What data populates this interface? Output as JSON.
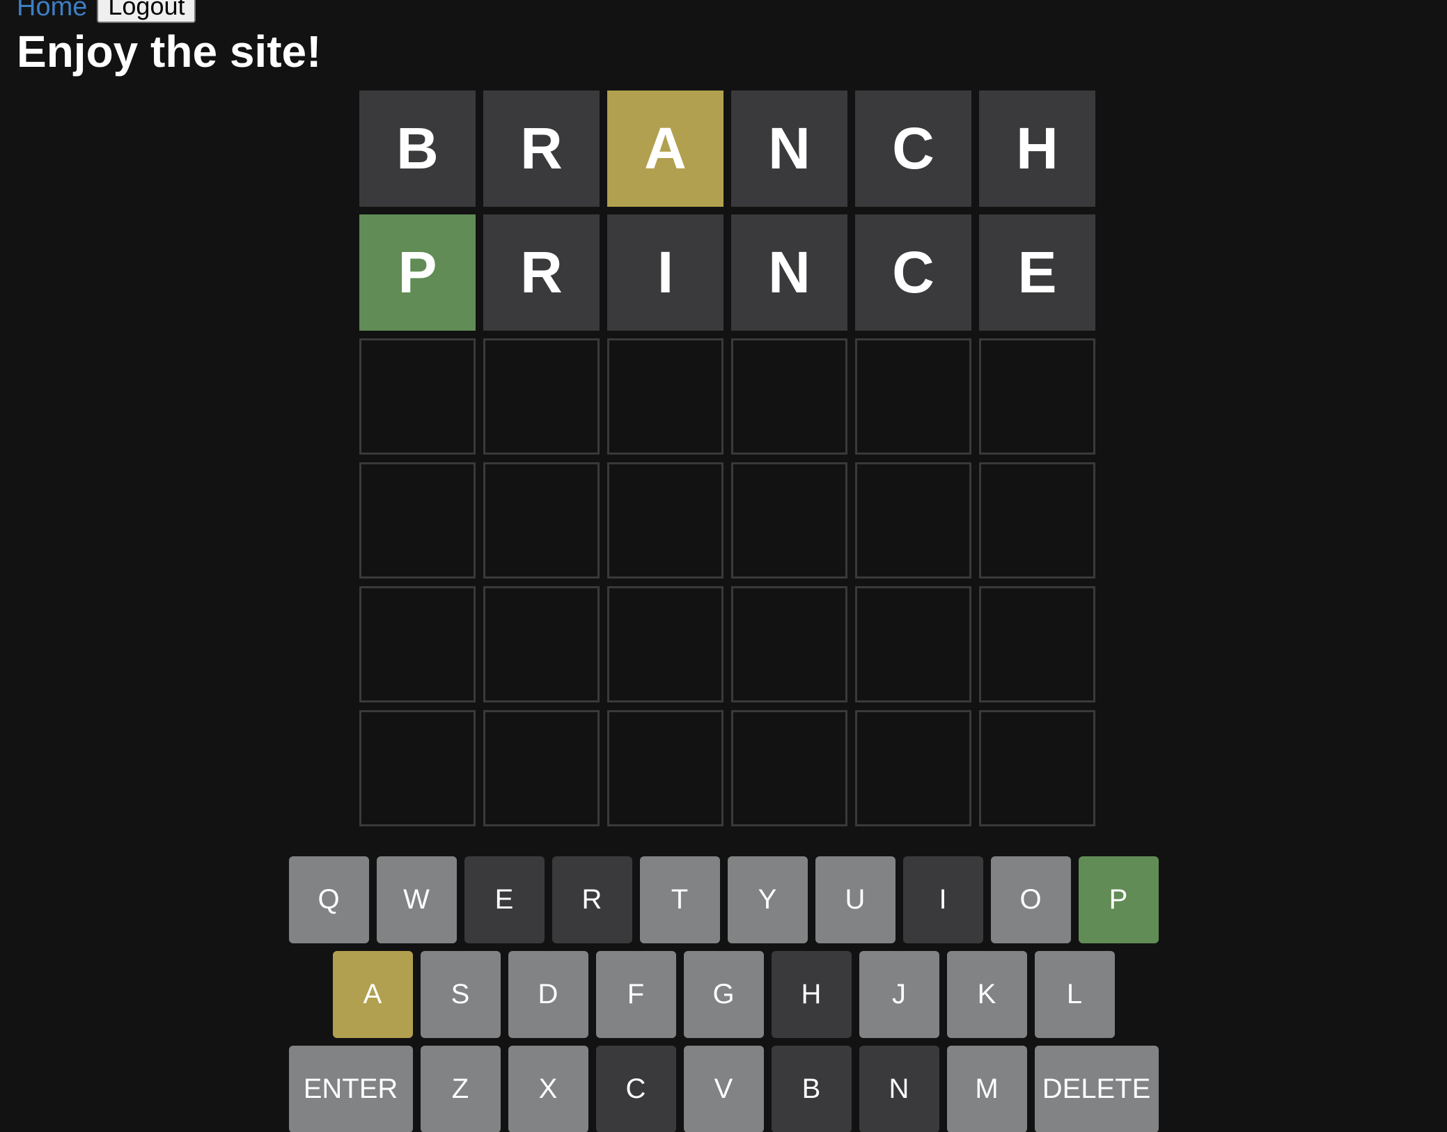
{
  "nav": {
    "home_label": "Home",
    "logout_label": "Logout"
  },
  "title": "Enjoy the site!",
  "colors": {
    "correct": "#618c55",
    "present": "#b1a04f",
    "absent": "#3a3a3c",
    "unused_key": "#818384",
    "background": "#121212",
    "empty_tile_border": "#3a3a3c"
  },
  "board": {
    "columns": 6,
    "rows": [
      {
        "tiles": [
          {
            "letter": "B",
            "state": "absent"
          },
          {
            "letter": "R",
            "state": "absent"
          },
          {
            "letter": "A",
            "state": "present"
          },
          {
            "letter": "N",
            "state": "absent"
          },
          {
            "letter": "C",
            "state": "absent"
          },
          {
            "letter": "H",
            "state": "absent"
          }
        ]
      },
      {
        "tiles": [
          {
            "letter": "P",
            "state": "correct"
          },
          {
            "letter": "R",
            "state": "absent"
          },
          {
            "letter": "I",
            "state": "absent"
          },
          {
            "letter": "N",
            "state": "absent"
          },
          {
            "letter": "C",
            "state": "absent"
          },
          {
            "letter": "E",
            "state": "absent"
          }
        ]
      },
      {
        "tiles": [
          {
            "letter": "",
            "state": "empty"
          },
          {
            "letter": "",
            "state": "empty"
          },
          {
            "letter": "",
            "state": "empty"
          },
          {
            "letter": "",
            "state": "empty"
          },
          {
            "letter": "",
            "state": "empty"
          },
          {
            "letter": "",
            "state": "empty"
          }
        ]
      },
      {
        "tiles": [
          {
            "letter": "",
            "state": "empty"
          },
          {
            "letter": "",
            "state": "empty"
          },
          {
            "letter": "",
            "state": "empty"
          },
          {
            "letter": "",
            "state": "empty"
          },
          {
            "letter": "",
            "state": "empty"
          },
          {
            "letter": "",
            "state": "empty"
          }
        ]
      },
      {
        "tiles": [
          {
            "letter": "",
            "state": "empty"
          },
          {
            "letter": "",
            "state": "empty"
          },
          {
            "letter": "",
            "state": "empty"
          },
          {
            "letter": "",
            "state": "empty"
          },
          {
            "letter": "",
            "state": "empty"
          },
          {
            "letter": "",
            "state": "empty"
          }
        ]
      },
      {
        "tiles": [
          {
            "letter": "",
            "state": "empty"
          },
          {
            "letter": "",
            "state": "empty"
          },
          {
            "letter": "",
            "state": "empty"
          },
          {
            "letter": "",
            "state": "empty"
          },
          {
            "letter": "",
            "state": "empty"
          },
          {
            "letter": "",
            "state": "empty"
          }
        ]
      }
    ]
  },
  "keyboard": {
    "rows": [
      [
        {
          "label": "Q",
          "state": "unused"
        },
        {
          "label": "W",
          "state": "unused"
        },
        {
          "label": "E",
          "state": "absent"
        },
        {
          "label": "R",
          "state": "absent"
        },
        {
          "label": "T",
          "state": "unused"
        },
        {
          "label": "Y",
          "state": "unused"
        },
        {
          "label": "U",
          "state": "unused"
        },
        {
          "label": "I",
          "state": "absent"
        },
        {
          "label": "O",
          "state": "unused"
        },
        {
          "label": "P",
          "state": "correct"
        }
      ],
      [
        {
          "label": "A",
          "state": "present"
        },
        {
          "label": "S",
          "state": "unused"
        },
        {
          "label": "D",
          "state": "unused"
        },
        {
          "label": "F",
          "state": "unused"
        },
        {
          "label": "G",
          "state": "unused"
        },
        {
          "label": "H",
          "state": "absent"
        },
        {
          "label": "J",
          "state": "unused"
        },
        {
          "label": "K",
          "state": "unused"
        },
        {
          "label": "L",
          "state": "unused"
        }
      ],
      [
        {
          "label": "ENTER",
          "state": "unused",
          "wide": true
        },
        {
          "label": "Z",
          "state": "unused"
        },
        {
          "label": "X",
          "state": "unused"
        },
        {
          "label": "C",
          "state": "absent"
        },
        {
          "label": "V",
          "state": "unused"
        },
        {
          "label": "B",
          "state": "absent"
        },
        {
          "label": "N",
          "state": "absent"
        },
        {
          "label": "M",
          "state": "unused"
        },
        {
          "label": "DELETE",
          "state": "unused",
          "wide": true
        }
      ]
    ]
  }
}
